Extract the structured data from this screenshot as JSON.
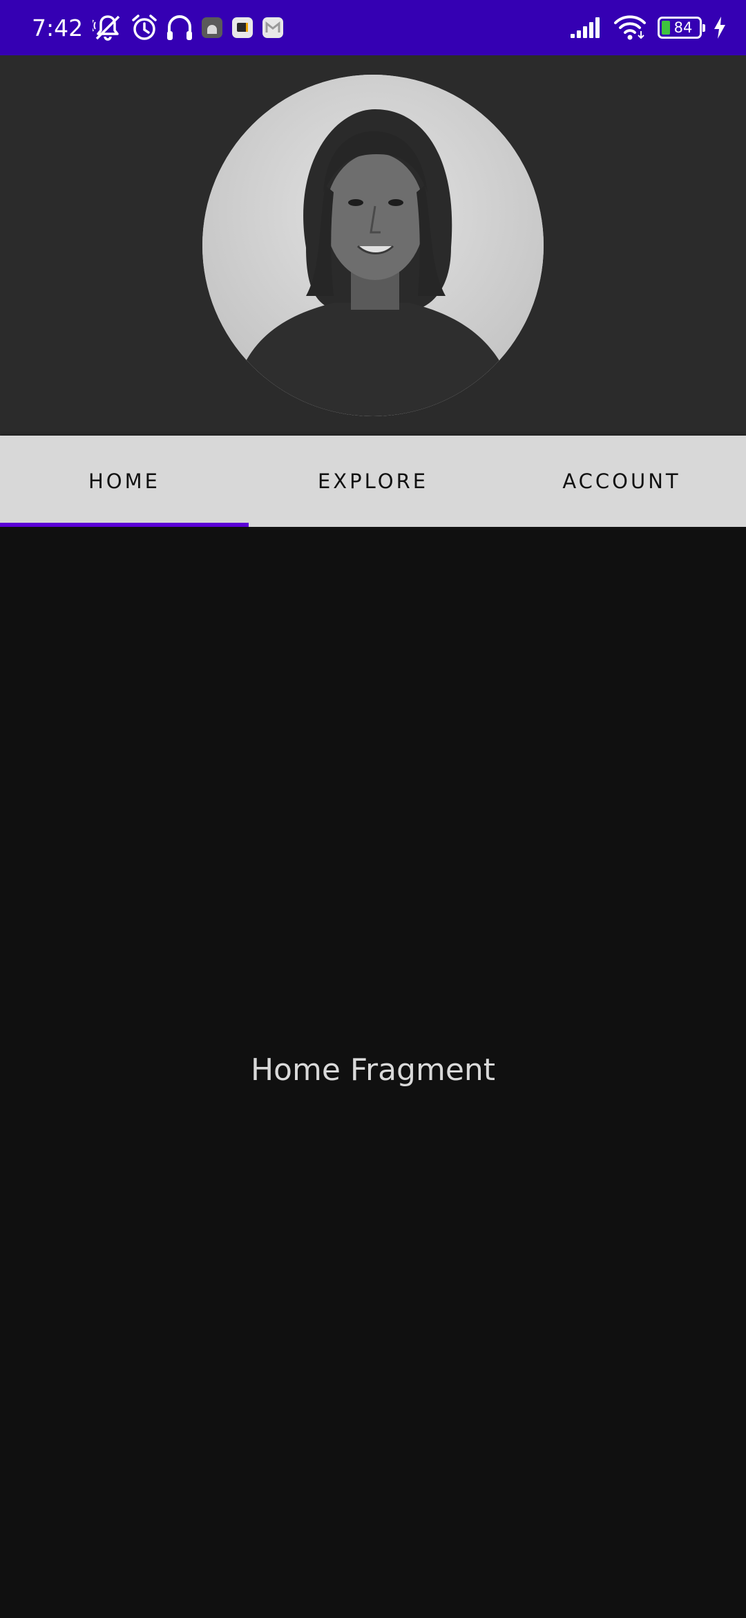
{
  "status_bar": {
    "time": "7:42",
    "battery_level": "84",
    "icons": [
      "bell-off-icon",
      "alarm-icon",
      "headphones-icon",
      "android-icon",
      "app-icon",
      "gmail-icon",
      "signal-icon",
      "wifi-icon",
      "battery-icon",
      "charging-icon"
    ],
    "background_color": "#3500b3"
  },
  "header": {
    "avatar_alt": "profile-photo"
  },
  "tabs": [
    {
      "label": "HOME",
      "selected": true
    },
    {
      "label": "EXPLORE",
      "selected": false
    },
    {
      "label": "ACCOUNT",
      "selected": false
    }
  ],
  "accent_color": "#5b00d6",
  "content": {
    "fragment_text": "Home Fragment"
  }
}
